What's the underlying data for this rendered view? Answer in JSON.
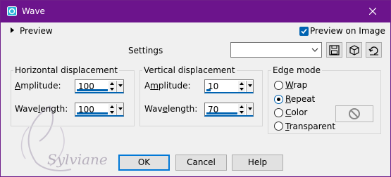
{
  "window": {
    "title": "Wave",
    "accent": "#6c148c",
    "close_icon": "close-icon"
  },
  "preview": {
    "label": "Preview",
    "preview_on_image_label": "Preview on Image",
    "preview_on_image_checked": true
  },
  "settings": {
    "label": "Settings",
    "preset_value": "",
    "icons": [
      "save-preset-icon",
      "random-icon",
      "reset-icon"
    ]
  },
  "horizontal": {
    "title": "Horizontal displacement",
    "amplitude_label_pre": "",
    "amplitude_label_ul": "A",
    "amplitude_label_post": "mplitude:",
    "amplitude_value": "100",
    "wavelength_label_pre": "Wave",
    "wavelength_label_ul": "l",
    "wavelength_label_post": "ength:",
    "wavelength_value": "100"
  },
  "vertical": {
    "title": "Vertical displacement",
    "amplitude_label_pre": "A",
    "amplitude_label_ul": "m",
    "amplitude_label_post": "plitude:",
    "amplitude_value": "10",
    "wavelength_label_pre": "Wav",
    "wavelength_label_ul": "e",
    "wavelength_label_post": "length:",
    "wavelength_value": "70"
  },
  "edge_mode": {
    "title": "Edge mode",
    "options": [
      {
        "pre": "",
        "ul": "W",
        "post": "rap",
        "checked": false
      },
      {
        "pre": "",
        "ul": "R",
        "post": "epeat",
        "checked": true
      },
      {
        "pre": "",
        "ul": "C",
        "post": "olor",
        "checked": false
      },
      {
        "pre": "",
        "ul": "T",
        "post": "ransparent",
        "checked": false
      }
    ],
    "color_swatch_icon": "no-color-icon"
  },
  "buttons": {
    "ok": "OK",
    "cancel": "Cancel",
    "help": "Help"
  },
  "watermark": {
    "text": "Sylviane"
  }
}
